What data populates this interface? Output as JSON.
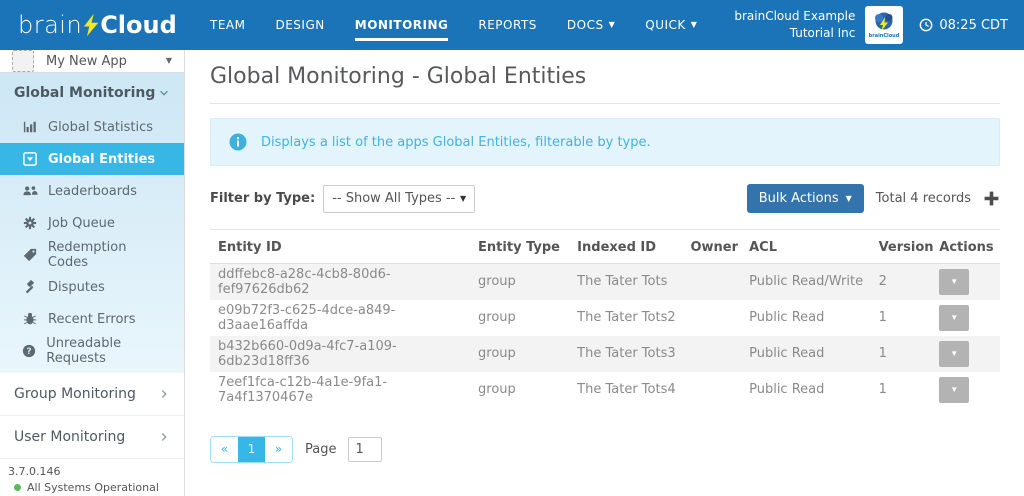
{
  "header": {
    "brand_light": "brain",
    "brand_bold": "Cloud",
    "nav": [
      {
        "label": "TEAM",
        "active": false
      },
      {
        "label": "DESIGN",
        "active": false
      },
      {
        "label": "MONITORING",
        "active": true
      },
      {
        "label": "REPORTS",
        "active": false
      },
      {
        "label": "DOCS",
        "active": false,
        "dropdown": true
      },
      {
        "label": "QUICK",
        "active": false,
        "dropdown": true
      }
    ],
    "account_line1": "brainCloud Example",
    "account_line2": "Tutorial Inc",
    "time": "08:25 CDT"
  },
  "sidebar": {
    "app_selector": "My New App",
    "section_title": "Global Monitoring",
    "items": [
      {
        "label": "Global Statistics",
        "icon": "bar-chart-icon",
        "active": false
      },
      {
        "label": "Global Entities",
        "icon": "caret-square-down-icon",
        "active": true
      },
      {
        "label": "Leaderboards",
        "icon": "users-icon",
        "active": false
      },
      {
        "label": "Job Queue",
        "icon": "gear-icon",
        "active": false
      },
      {
        "label": "Redemption Codes",
        "icon": "tag-icon",
        "active": false
      },
      {
        "label": "Disputes",
        "icon": "gavel-icon",
        "active": false
      },
      {
        "label": "Recent Errors",
        "icon": "bug-icon",
        "active": false
      },
      {
        "label": "Unreadable Requests",
        "icon": "question-circle-icon",
        "active": false
      }
    ],
    "group_monitoring": "Group Monitoring",
    "user_monitoring": "User Monitoring",
    "version": "3.7.0.146",
    "status": "All Systems Operational"
  },
  "main": {
    "title": "Global Monitoring - Global Entities",
    "alert_text": "Displays a list of the apps Global Entities, filterable by type.",
    "filter_label": "Filter by Type:",
    "filter_value": "-- Show All Types --",
    "bulk_actions_label": "Bulk Actions",
    "total_records": "Total 4 records",
    "table": {
      "headers": [
        "Entity ID",
        "Entity Type",
        "Indexed ID",
        "Owner",
        "ACL",
        "Version",
        "Actions"
      ],
      "rows": [
        {
          "entity_id": "ddffebc8-a28c-4cb8-80d6-fef97626db62",
          "entity_type": "group",
          "indexed_id": "The Tater Tots",
          "owner": "",
          "acl": "Public Read/Write",
          "version": "2"
        },
        {
          "entity_id": "e09b72f3-c625-4dce-a849-d3aae16affda",
          "entity_type": "group",
          "indexed_id": "The Tater Tots2",
          "owner": "",
          "acl": "Public Read",
          "version": "1"
        },
        {
          "entity_id": "b432b660-0d9a-4fc7-a109-6db23d18ff36",
          "entity_type": "group",
          "indexed_id": "The Tater Tots3",
          "owner": "",
          "acl": "Public Read",
          "version": "1"
        },
        {
          "entity_id": "7eef1fca-c12b-4a1e-9fa1-7a4f1370467e",
          "entity_type": "group",
          "indexed_id": "The Tater Tots4",
          "owner": "",
          "acl": "Public Read",
          "version": "1"
        }
      ]
    },
    "pagination": {
      "prev": "«",
      "page": "1",
      "next": "»",
      "label": "Page",
      "input_value": "1"
    }
  },
  "colors": {
    "header_blue": "#1b74b8",
    "active_blue": "#36b7e5",
    "button_blue": "#3474ad",
    "alert_text": "#41b3de",
    "bolt_yellow": "#f3e921",
    "status_green": "#5cb85c",
    "stripe_gray": "#f3f3f3"
  }
}
